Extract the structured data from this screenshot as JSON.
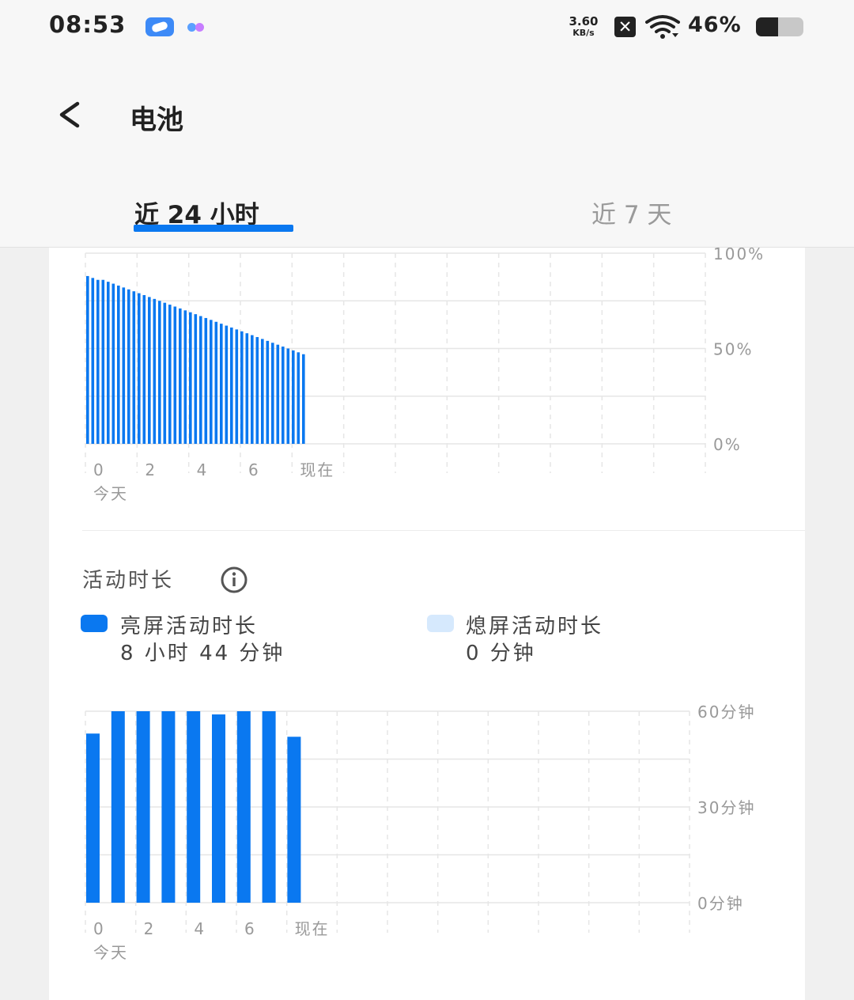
{
  "status_bar": {
    "time": "08:53",
    "net_speed_value": "3.60",
    "net_speed_unit": "KB/s",
    "battery_text": "46%",
    "battery_level": 0.46,
    "icons": [
      "app-notification-icon",
      "app-notification-icon-2",
      "x-app-icon",
      "wifi-icon",
      "battery-icon"
    ]
  },
  "header": {
    "title": "电池",
    "back_icon": "chevron-left-icon"
  },
  "tabs": [
    {
      "label": "近 24 小时",
      "selected": true
    },
    {
      "label": "近 7 天",
      "selected": false
    }
  ],
  "colors": {
    "accent": "#0a78f0",
    "screen_off": "#d6e9fd",
    "grid": "#e6e6e6",
    "axis_text": "#999999"
  },
  "activity": {
    "title": "活动时长",
    "info_icon": "info-icon",
    "legend": [
      {
        "label": "亮屏活动时长",
        "value": "8 小时 44 分钟",
        "color": "#0a78f0"
      },
      {
        "label": "熄屏活动时长",
        "value": "0 分钟",
        "color": "#d6e9fd"
      }
    ]
  },
  "chart_data": [
    {
      "type": "bar",
      "y_tick_labels": [
        "100%",
        "50%",
        "0%"
      ],
      "x_tick_labels": [
        "0",
        "2",
        "4",
        "6",
        "现在"
      ],
      "x_sublabel": "今天",
      "ylim": [
        0,
        100
      ],
      "grid": true,
      "values": [
        88,
        87,
        86,
        86,
        85,
        84,
        83,
        82,
        81,
        80,
        79,
        78,
        77,
        76,
        75,
        74,
        73,
        72,
        71,
        70,
        69,
        68,
        67,
        66,
        65,
        64,
        63,
        62,
        61,
        60,
        59,
        58,
        57,
        56,
        55,
        54,
        53,
        52,
        51,
        50,
        49,
        48,
        47
      ]
    },
    {
      "type": "bar",
      "y_tick_labels": [
        "60分钟",
        "30分钟",
        "0分钟"
      ],
      "x_tick_labels": [
        "0",
        "2",
        "4",
        "6",
        "现在"
      ],
      "x_sublabel": "今天",
      "ylim": [
        0,
        60
      ],
      "grid": true,
      "series": [
        {
          "name": "亮屏活动时长",
          "values": [
            53,
            60,
            60,
            60,
            60,
            59,
            60,
            60,
            52
          ]
        },
        {
          "name": "熄屏活动时长",
          "values": [
            0,
            0,
            0,
            0,
            0,
            0,
            0,
            0,
            0
          ]
        }
      ]
    }
  ]
}
